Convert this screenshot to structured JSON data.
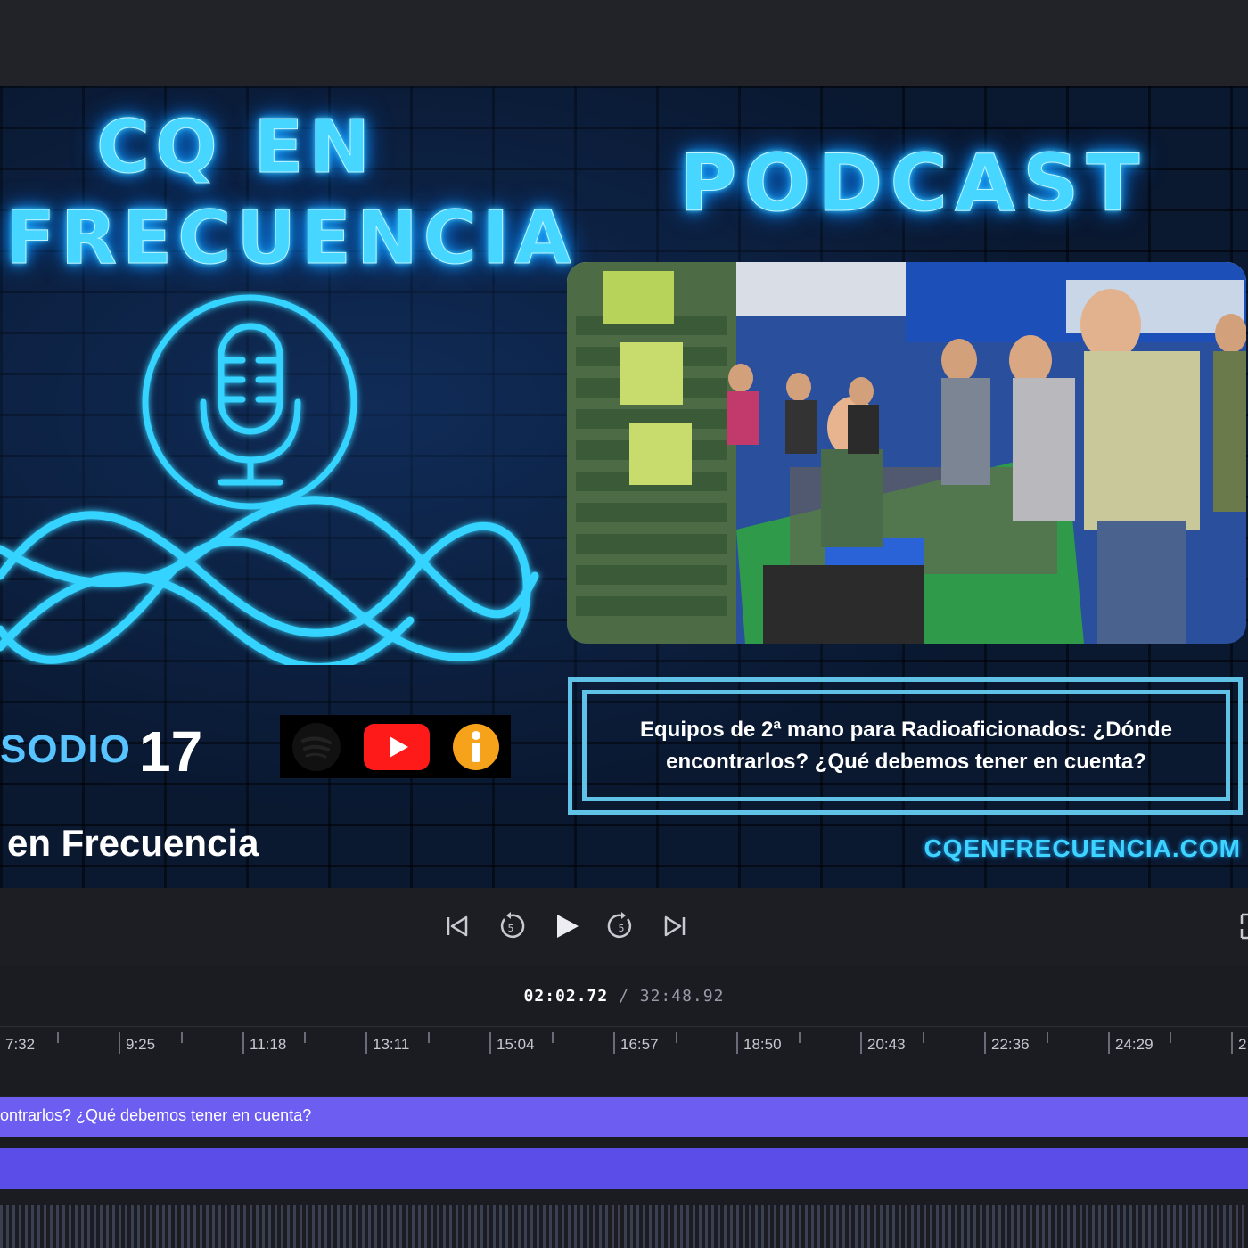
{
  "cover": {
    "title_line1": "CQ EN",
    "title_line2": "FRECUENCIA",
    "podcast_label": "PODCAST",
    "episode_label": "SODIO",
    "episode_number": "17",
    "show_name": "en Frecuencia",
    "episode_title_line1": "Equipos de 2ª mano para Radioaficionados: ¿Dónde",
    "episode_title_line2": "encontrarlos? ¿Qué debemos tener en cuenta?",
    "website": "CQENFRECUENCIA.COM",
    "platforms": [
      "spotify-icon",
      "youtube-icon",
      "ivoox-icon"
    ],
    "neon_color": "#46d6ff"
  },
  "player": {
    "current_time": "02:02.72",
    "separator": " / ",
    "total_time": "32:48.92",
    "controls": [
      "skip-back",
      "rewind-5",
      "play",
      "forward-5",
      "skip-forward"
    ]
  },
  "timeline": {
    "ticks": [
      "7:32",
      "9:25",
      "11:18",
      "13:11",
      "15:04",
      "16:57",
      "18:50",
      "20:43",
      "22:36",
      "24:29",
      "2"
    ],
    "track_title": "ontrarlos? ¿Qué debemos tener en cuenta?",
    "track_color": "#6d5df1"
  }
}
